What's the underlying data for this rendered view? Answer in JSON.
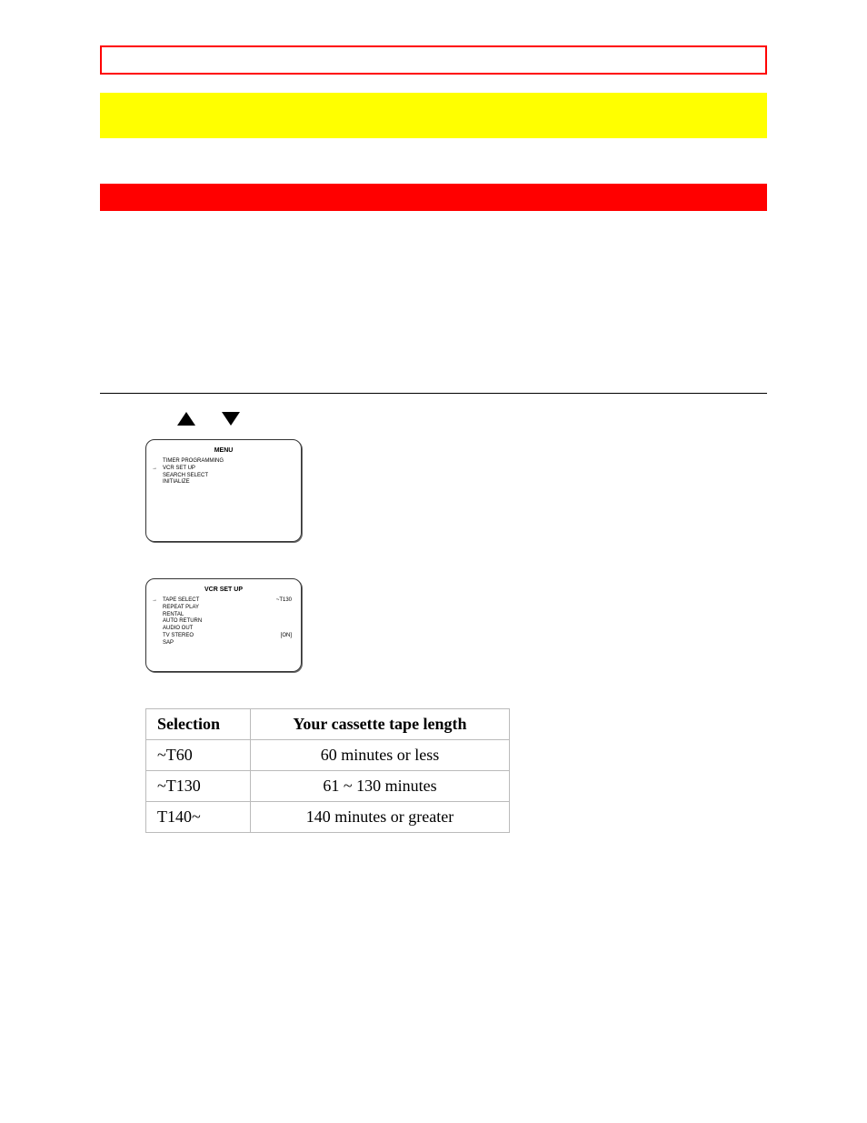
{
  "screen1": {
    "title": "MENU",
    "items": [
      {
        "label": "TIMER PROGRAMMING",
        "selected": false
      },
      {
        "label": "VCR SET UP",
        "selected": true
      },
      {
        "label": "SEARCH SELECT",
        "selected": false
      },
      {
        "label": "INITIALIZE",
        "selected": false
      }
    ]
  },
  "screen2": {
    "title": "VCR SET UP",
    "items": [
      {
        "label": "TAPE SELECT",
        "value": "~T130",
        "selected": true
      },
      {
        "label": "REPEAT PLAY",
        "selected": false
      },
      {
        "label": "RENTAL",
        "selected": false
      },
      {
        "label": "AUTO RETURN",
        "selected": false
      },
      {
        "label": "AUDIO OUT",
        "selected": false
      },
      {
        "label": "TV STEREO",
        "value": "[ON]",
        "selected": false
      },
      {
        "label": "SAP",
        "selected": false
      }
    ]
  },
  "table": {
    "headers": [
      "Selection",
      "Your cassette tape length"
    ],
    "rows": [
      [
        "~T60",
        "60 minutes or less"
      ],
      [
        "~T130",
        "61 ~ 130 minutes"
      ],
      [
        "T140~",
        "140 minutes or greater"
      ]
    ]
  }
}
